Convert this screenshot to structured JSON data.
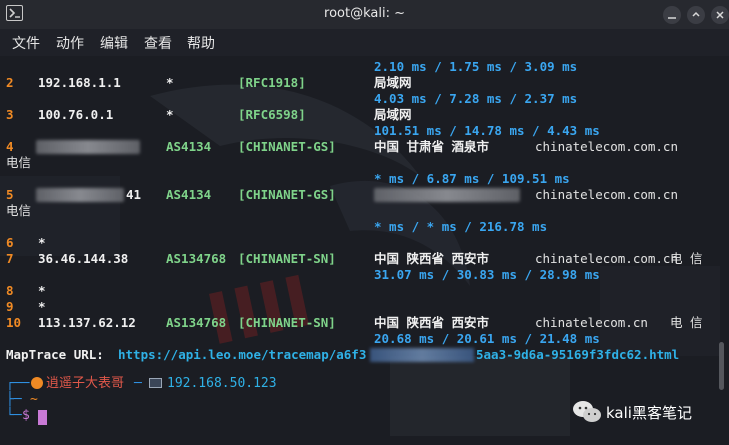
{
  "window": {
    "title": "root@kali: ~"
  },
  "menu": [
    "文件",
    "动作",
    "编辑",
    "查看",
    "帮助"
  ],
  "hops": [
    {
      "n": "2",
      "ip": "192.168.1.1",
      "star": "*",
      "tag": "[RFC1918]",
      "geo": "局域网",
      "rtt_pre": "2.10 ms / 1.75 ms / 3.09 ms",
      "rtt": "4.03 ms / 7.28 ms / 2.37 ms"
    },
    {
      "n": "3",
      "ip": "100.76.0.1",
      "star": "*",
      "tag": "[RFC6598]",
      "geo": "局域网",
      "rtt": "101.51 ms / 14.78 ms / 4.43 ms"
    },
    {
      "n": "4",
      "asn": "AS4134",
      "tag": "[CHINANET-GS]",
      "geo": "中国 甘肃省 酒泉市",
      "domain": "chinatelecom.com.cn",
      "isp": "电信",
      "rtt": "* ms / 6.87 ms / 109.51 ms"
    },
    {
      "n": "5",
      "ip_tail": "41",
      "asn": "AS4134",
      "tag": "[CHINANET-GS]",
      "domain": "chinatelecom.com.cn",
      "isp": "电信",
      "rtt": "* ms / * ms / 216.78 ms"
    },
    {
      "n": "6",
      "ip": "*"
    },
    {
      "n": "7",
      "ip": "36.46.144.38",
      "asn": "AS134768",
      "tag": "[CHINANET-SN]",
      "geo": "中国 陕西省 西安市",
      "domain": "chinatelecom.com.cn",
      "isp": "电 信",
      "rtt": "31.07 ms / 30.83 ms / 28.98 ms"
    },
    {
      "n": "8",
      "ip": "*"
    },
    {
      "n": "9",
      "ip": "*"
    },
    {
      "n": "10",
      "ip": "113.137.62.12",
      "asn": "AS134768",
      "tag": "[CHINANET-SN]",
      "geo": "中国 陕西省 西安市",
      "domain": "chinatelecom.cn",
      "isp": "电 信",
      "rtt": "20.68 ms / 20.61 ms / 21.48 ms"
    }
  ],
  "maptrace": {
    "label": "MapTrace URL:",
    "url_start": "https://api.leo.moe/tracemap/a6f3",
    "url_end": "5aa3-9d6a-95169f3fdc62.html"
  },
  "prompt": {
    "user": "逍遥子大表哥",
    "ip": "192.168.50.123",
    "dir": "~",
    "symbol": "$"
  },
  "watermark": {
    "text": "kali黑客笔记"
  }
}
